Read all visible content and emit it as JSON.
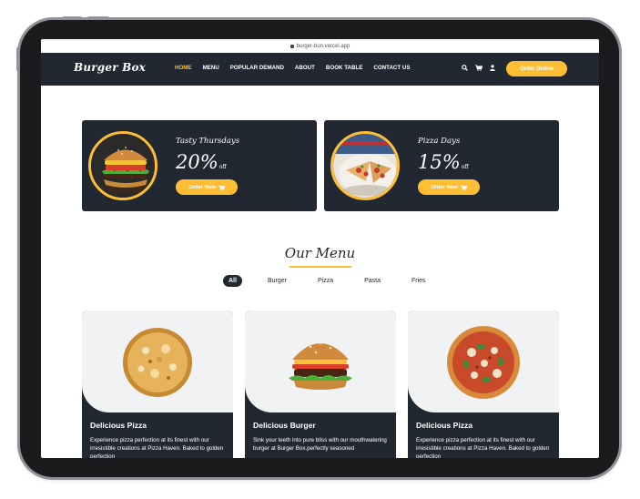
{
  "browser": {
    "url": "burger-bun.vercel.app"
  },
  "nav": {
    "brand": "Burger Box",
    "items": [
      {
        "label": "HOME",
        "active": true
      },
      {
        "label": "MENU",
        "active": false
      },
      {
        "label": "POPULAR DEMAND",
        "active": false
      },
      {
        "label": "ABOUT",
        "active": false
      },
      {
        "label": "BOOK TABLE",
        "active": false
      },
      {
        "label": "CONTACT US",
        "active": false
      }
    ],
    "icons": [
      "search-icon",
      "cart-icon",
      "user-icon"
    ],
    "cta": "Order Online"
  },
  "offers": [
    {
      "title": "Tasty Thursdays",
      "percent": "20%",
      "suffix": "off",
      "button": "Order Now"
    },
    {
      "title": "Pizza Days",
      "percent": "15%",
      "suffix": "off",
      "button": "Order Now"
    }
  ],
  "menu_section": {
    "heading": "Our Menu",
    "filters": [
      {
        "label": "All",
        "active": true
      },
      {
        "label": "Burger",
        "active": false
      },
      {
        "label": "Pizza",
        "active": false
      },
      {
        "label": "Pasta",
        "active": false
      },
      {
        "label": "Fries",
        "active": false
      }
    ]
  },
  "products": [
    {
      "title": "Delicious Pizza",
      "desc": "Experience pizza perfection at its finest with our irresistible creations at Pizza Haven. Baked to golden perfection"
    },
    {
      "title": "Delicious Burger",
      "desc": "Sink your teeth into pure bliss with our mouthwatering burger at Burger Box.perfectly seasoned"
    },
    {
      "title": "Delicious Pizza",
      "desc": "Experience pizza perfection at its finest with our irresistible creations at Pizza Haven. Baked to golden perfection"
    }
  ],
  "colors": {
    "dark": "#222831",
    "accent": "#ffbe33",
    "card_bg": "#f1f2f3"
  }
}
